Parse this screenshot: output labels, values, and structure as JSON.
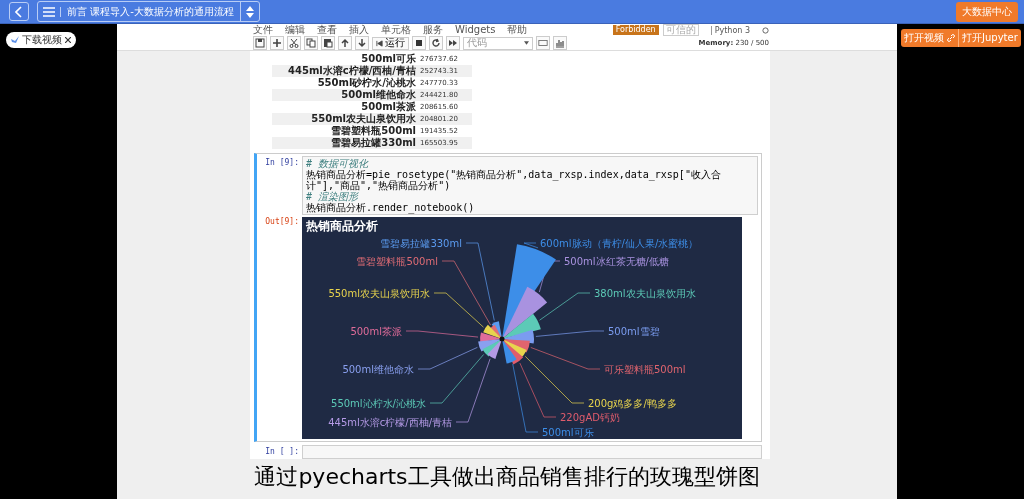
{
  "topbar": {
    "title": "前言 课程导入-大数据分析的通用流程",
    "right_button": "大数据中心"
  },
  "download_chip": "下载视频",
  "side_buttons": [
    "打开视频",
    "打开Jupyter"
  ],
  "notebook": {
    "menu": [
      "文件",
      "编辑",
      "查看",
      "插入",
      "单元格",
      "服务",
      "Widgets",
      "帮助"
    ],
    "status_badge": "Forbidden",
    "trusted": "可信的",
    "kernel": "Python 3",
    "run_label": "运行",
    "cell_type": "代码",
    "memory_label": "Memory:",
    "memory_value": "230 / 500"
  },
  "table": [
    {
      "name": "500ml可乐",
      "value": "276737.62"
    },
    {
      "name": "445ml水溶c柠檬/西柚/青桔",
      "value": "252743.31"
    },
    {
      "name": "550ml砂柠水/沁桃水",
      "value": "247770.33"
    },
    {
      "name": "500ml维他命水",
      "value": "244421.80"
    },
    {
      "name": "500ml茶派",
      "value": "208615.60"
    },
    {
      "name": "550ml农夫山泉饮用水",
      "value": "204801.20"
    },
    {
      "name": "雪碧塑料瓶500ml",
      "value": "191435.52"
    },
    {
      "name": "雪碧易拉罐330ml",
      "value": "165503.95"
    }
  ],
  "cell": {
    "prompt": "In  [9]:",
    "out_prompt": "Out[9]:",
    "lines": [
      {
        "kind": "comment",
        "text": "# 数据可视化"
      },
      {
        "kind": "code",
        "text": "热销商品分析=pie_rosetype(\"热销商品分析\",data_rxsp.index,data_rxsp[\"收入合计\"],\"商品\",\"热销商品分析\")"
      },
      {
        "kind": "comment",
        "text": "# 渲染图形"
      },
      {
        "kind": "code",
        "text": "热销商品分析.render_notebook()"
      }
    ]
  },
  "chart": {
    "title": "热销商品分析",
    "labels": [
      {
        "text": "雪碧易拉罐330ml",
        "color": "#5b9bf0"
      },
      {
        "text": "600ml脉动（青柠/仙人果/水蜜桃）",
        "color": "#3d8ee8"
      },
      {
        "text": "雪碧塑料瓶500ml",
        "color": "#e06c75"
      },
      {
        "text": "500ml冰红茶无糖/低糖",
        "color": "#a992e0"
      },
      {
        "text": "550ml农夫山泉饮用水",
        "color": "#e8d44d"
      },
      {
        "text": "380ml农夫山泉饮用水",
        "color": "#5ccab7"
      },
      {
        "text": "500ml茶派",
        "color": "#e06c9a"
      },
      {
        "text": "500ml雪碧",
        "color": "#7b9cf0"
      },
      {
        "text": "500ml维他命水",
        "color": "#8aa0f0"
      },
      {
        "text": "可乐塑料瓶500ml",
        "color": "#e0646e"
      },
      {
        "text": "550ml沁柠水/沁桃水",
        "color": "#5ccab7"
      },
      {
        "text": "200g鸡多多/鸭多多",
        "color": "#e8d44d"
      },
      {
        "text": "445ml水溶c柠檬/西柚/青桔",
        "color": "#b49ae6"
      },
      {
        "text": "220gAD钙奶",
        "color": "#e05c6c"
      },
      {
        "text": "500ml可乐",
        "color": "#3d8ee8"
      }
    ]
  },
  "empty_cell": {
    "prompt": "In  [ ]:"
  },
  "subtitle": "通过pyecharts工具做出商品销售排行的玫瑰型饼图"
}
